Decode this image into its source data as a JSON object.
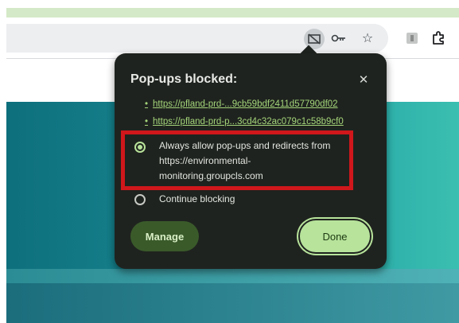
{
  "browser": {
    "toolbar_icons": {
      "popups_blocked": "popup-blocked-icon",
      "password_key": "key-icon",
      "bookmark_star": "star-icon",
      "extension": "extension-icon",
      "extensions_puzzle": "puzzle-icon"
    }
  },
  "popup_bubble": {
    "title": "Pop-ups blocked:",
    "close_glyph": "✕",
    "blocked_links": [
      "https://pfland-prd-...9cb59bdf2411d57790df02",
      "https://pfland-prd-p...3cd4c32ac079c1c58b9cf0"
    ],
    "bullet": "•",
    "options": {
      "allow_label": "Always allow pop-ups and redirects from https://environmental-monitoring.groupcls.com",
      "block_label": "Continue blocking",
      "selected": "allow"
    },
    "manage_label": "Manage",
    "done_label": "Done"
  },
  "colors": {
    "bubble_bg": "#1f231f",
    "link": "#a4d57a",
    "accent": "#b7e39b",
    "annotation_red": "#d0171b",
    "page_teal": "#16838d"
  }
}
